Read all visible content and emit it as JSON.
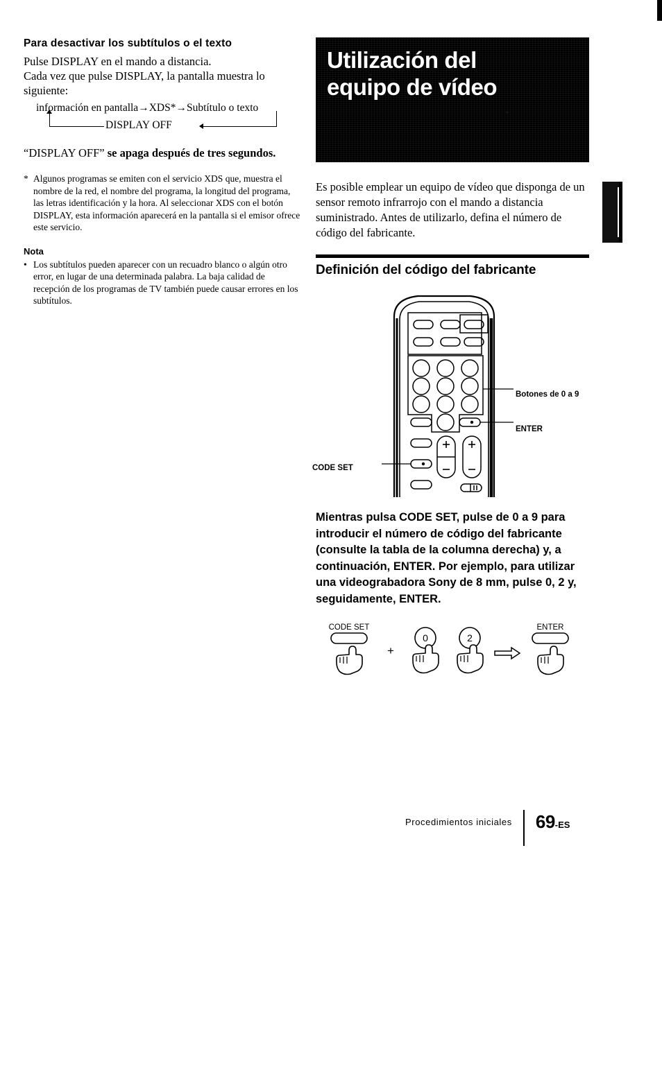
{
  "page": {
    "number": "69",
    "number_suffix": "-ES",
    "chapter": "Procedimientos iniciales"
  },
  "left_column": {
    "heading": "Para desactivar los subtítulos o el texto",
    "para_line1": "Pulse DISPLAY en el mando a distancia.",
    "para_line2": "Cada vez que pulse DISPLAY, la pantalla muestra lo",
    "para_line3": "siguiente:",
    "flow_top": "información en pantalla→XDS*→Subtítulo o texto",
    "flow_bottom": "DISPLAY OFF",
    "display_off_note_pre": "“DISPLAY OFF” ",
    "display_off_note_bold": "se apaga después de tres segundos.",
    "footnote_bullet": "*",
    "footnote_text": "Algunos programas se emiten con el servicio XDS que, muestra el nombre de la red, el nombre del programa, la longitud del programa, las letras identificación y la hora. Al seleccionar XDS con el botón DISPLAY, esta información aparecerá en la pantalla si el emisor ofrece este servicio.",
    "note_heading": "Nota",
    "note_bullet": "•",
    "note_text": "Los subtítulos pueden aparecer con un recuadro blanco o algún otro error, en lugar de una determinada palabra. La baja calidad de recepción de los programas de TV también puede causar errores en los subtítulos."
  },
  "right_column": {
    "banner_line1": "Utilización del",
    "banner_line2": "equipo de vídeo",
    "banner_bg": "#000000",
    "banner_text_color": "#ffffff",
    "intro": "Es posible emplear un equipo de vídeo que disponga de un sensor remoto infrarrojo con el mando a distancia suministrado. Antes de utilizarlo, defina el número de código del fabricante.",
    "section_heading": "Definición del código del fabricante",
    "instruction": "Mientras pulsa CODE SET, pulse de 0 a 9 para introducir el número de código del fabricante (consulte la tabla de la columna derecha) y, a continuación, ENTER. Por ejemplo, para utilizar una videograbadora Sony de 8 mm, pulse 0, 2 y, seguidamente, ENTER."
  },
  "remote_figure": {
    "callouts": [
      {
        "label": "Botones de 0 a 9"
      },
      {
        "label": "ENTER"
      },
      {
        "label": "CODE SET"
      }
    ]
  },
  "hand_steps": {
    "step1_label": "CODE SET",
    "plus_sign": "+",
    "step2_label": "0",
    "step3_label": "2",
    "arrow_sign": "⇒",
    "step4_label": "ENTER"
  }
}
